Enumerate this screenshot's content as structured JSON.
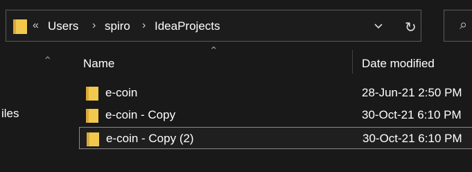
{
  "address_bar": {
    "overflow_label": "«",
    "crumbs": [
      "Users",
      "spiro",
      "IdeaProjects"
    ],
    "separator": "›",
    "dropdown_icon": "chevron-down-icon",
    "refresh_icon": "refresh-icon",
    "refresh_glyph": "↻"
  },
  "search": {
    "icon": "search-icon",
    "glyph": "⌕"
  },
  "nav_pane": {
    "scroll_up_glyph": "⌃",
    "partial_label": "iles"
  },
  "columns": {
    "name": "Name",
    "date_modified": "Date modified",
    "sort_glyph": "⌃"
  },
  "files": [
    {
      "name": "e-coin",
      "date": "28-Jun-21 2:50 PM",
      "selected": false
    },
    {
      "name": "e-coin - Copy",
      "date": "30-Oct-21 6:10 PM",
      "selected": false
    },
    {
      "name": "e-coin - Copy (2)",
      "date": "30-Oct-21 6:10 PM",
      "selected": true
    }
  ],
  "colors": {
    "folder": "#f2c94c",
    "folder_dark": "#d9a93a",
    "background": "#191919"
  }
}
